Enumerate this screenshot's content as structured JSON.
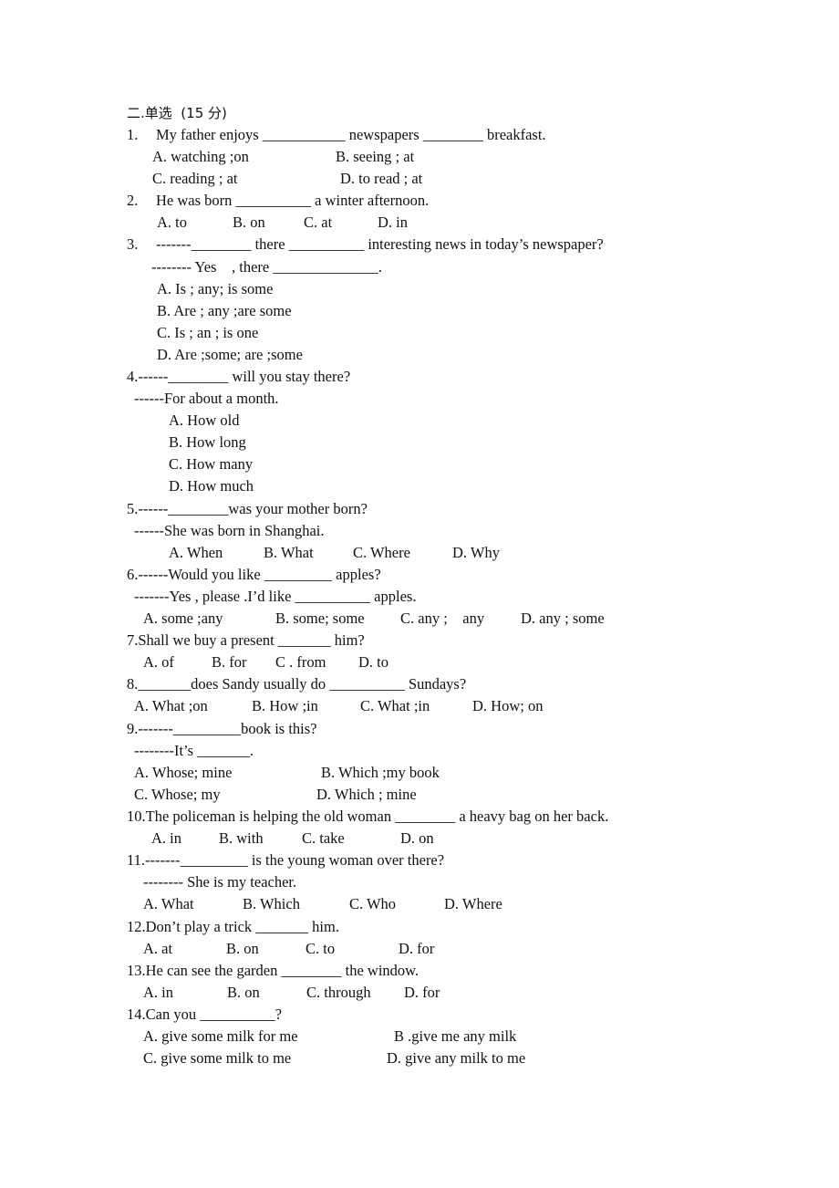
{
  "section_title": "二.单选  (15 分)",
  "questions": [
    {
      "number": "1.",
      "stem": [
        "My father enjoys ___________ newspapers ________ breakfast."
      ],
      "options": [
        "A. watching ;on",
        "B. seeing ; at",
        "C. reading ; at",
        "D. to read ; at"
      ]
    },
    {
      "number": "2.",
      "stem": [
        "He was born __________ a winter afternoon."
      ],
      "options": [
        "A. to",
        "B. on",
        "C. at",
        "D. in"
      ]
    },
    {
      "number": "3.",
      "stem": [
        "-------________ there __________ interesting news in today’s newspaper?",
        "-------- Yes    , there ______________."
      ],
      "options": [
        "A. Is ; any; is some",
        "B. Are ; any ;are some",
        "C. Is ; an ; is one",
        "D. Are ;some; are ;some"
      ]
    },
    {
      "number": "4.",
      "stem": [
        "4.------________ will you stay there?",
        "------For about a month."
      ],
      "options": [
        "A. How old",
        "B. How long",
        "C. How many",
        "D. How much"
      ]
    },
    {
      "number": "5.",
      "stem": [
        "5.------________was your mother born?",
        "------She was born in Shanghai."
      ],
      "options": [
        "A. When",
        "B. What",
        "C. Where",
        "D. Why"
      ]
    },
    {
      "number": "6.",
      "stem": [
        "6.------Would you like _________ apples?",
        "-------Yes , please .I’d like __________ apples."
      ],
      "options": [
        "A. some ;any",
        "B. some; some",
        "C. any ;    any",
        "D. any ; some"
      ]
    },
    {
      "number": "7.",
      "stem": [
        "7.Shall we buy a present _______ him?"
      ],
      "options": [
        "A. of",
        "B. for",
        "C . from",
        "D. to"
      ]
    },
    {
      "number": "8.",
      "stem": [
        "8._______does Sandy usually do __________ Sundays?"
      ],
      "options": [
        "A. What ;on",
        "B. How ;in",
        "C. What ;in",
        "D. How; on"
      ]
    },
    {
      "number": "9.",
      "stem": [
        "9.-------_________book is this?",
        "--------It’s _______."
      ],
      "options": [
        "A. Whose; mine",
        "B. Which ;my book",
        "C. Whose; my",
        "D. Which ; mine"
      ]
    },
    {
      "number": "10.",
      "stem": [
        "10.The policeman is helping the old woman ________ a heavy bag on her back."
      ],
      "options": [
        "A. in",
        "B. with",
        "C. take",
        "D. on"
      ]
    },
    {
      "number": "11.",
      "stem": [
        "11.-------_________ is the young woman over there?",
        "-------- She is my teacher."
      ],
      "options": [
        "A. What",
        "B. Which",
        "C. Who",
        "D. Where"
      ]
    },
    {
      "number": "12.",
      "stem": [
        "12.Don’t play a trick _______ him."
      ],
      "options": [
        "A. at",
        "B. on",
        "C. to",
        "D. for"
      ]
    },
    {
      "number": "13.",
      "stem": [
        "13.He can see the garden ________ the window."
      ],
      "options": [
        "A. in",
        "B. on",
        "C. through",
        "D. for"
      ]
    },
    {
      "number": "14.",
      "stem": [
        "14.Can you __________?"
      ],
      "options": [
        "A. give some milk for me",
        "B .give me any milk",
        "C. give some milk to me",
        "D. give any milk to me"
      ]
    }
  ]
}
